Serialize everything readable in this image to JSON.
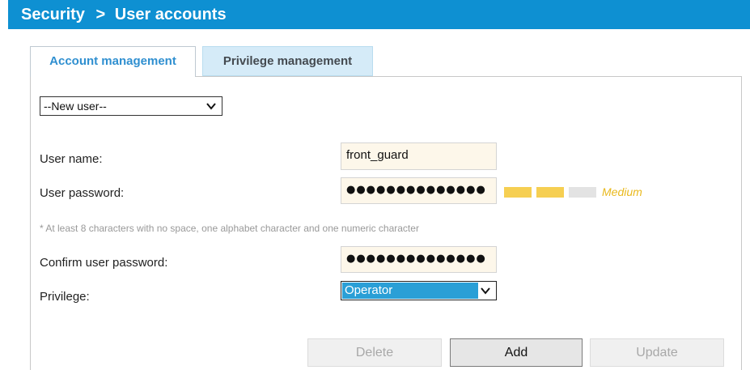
{
  "header": {
    "section": "Security",
    "separator": ">",
    "page": "User accounts"
  },
  "tabs": [
    {
      "label": "Account management",
      "active": true
    },
    {
      "label": "Privilege management",
      "active": false
    }
  ],
  "user_select": {
    "value": "--New user--"
  },
  "form": {
    "username_label": "User name:",
    "username_value": "front_guard",
    "password_label": "User password:",
    "password_value": "●●●●●●●●●●●●●●",
    "strength": {
      "label": "Medium",
      "level": 2,
      "max": 3
    },
    "hint": "* At least 8 characters with no space, one alphabet character and one numeric character",
    "confirm_label": "Confirm user password:",
    "confirm_value": "●●●●●●●●●●●●●●",
    "privilege_label": "Privilege:",
    "privilege_value": "Operator"
  },
  "buttons": {
    "delete": "Delete",
    "add": "Add",
    "update": "Update"
  },
  "colors": {
    "header_bg": "#0e90d2",
    "active_tab_text": "#2f8fd0",
    "inactive_tab_bg": "#d5ebf8",
    "field_bg": "#fdf7ea",
    "strength_filled": "#f6cf52",
    "strength_empty": "#e3e3e3",
    "strength_text": "#e9b91e",
    "select_highlight": "#2a9fd6"
  }
}
